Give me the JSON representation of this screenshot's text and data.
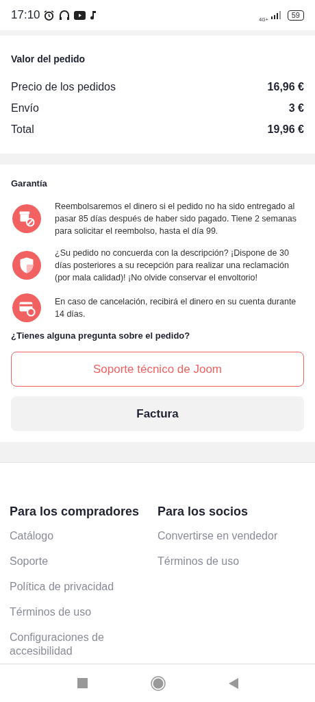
{
  "status_bar": {
    "time": "17:10",
    "network": "4G+",
    "battery": "59"
  },
  "order_value": {
    "title": "Valor del pedido",
    "rows": [
      {
        "label": "Precio de los pedidos",
        "value": "16,96 €"
      },
      {
        "label": "Envío",
        "value": "3 €"
      },
      {
        "label": "Total",
        "value": "19,96 €"
      }
    ]
  },
  "guarantee": {
    "title": "Garantía",
    "items": [
      {
        "kind": "box",
        "text": "Reembolsaremos el dinero si el pedido no ha sido entregado al pasar 85 días después de haber sido pagado. Tiene 2 semanas para solicitar el reembolso, hasta el día 99."
      },
      {
        "kind": "shield",
        "text": "¿Su pedido no concuerda con la descripción? ¡Dispone de 30 días posteriores a su recepción para realizar una reclamación (por mala calidad)! ¡No olvide conservar el envoltorio!"
      },
      {
        "kind": "card",
        "text": "En caso de cancelación, recibirá el dinero en su cuenta durante 14 días."
      }
    ],
    "question": "¿Tienes alguna pregunta sobre el pedido?",
    "buttons": [
      {
        "kind": "outline",
        "label": "Soporte técnico de Joom"
      },
      {
        "kind": "filled",
        "label": "Factura"
      }
    ]
  },
  "footer": {
    "columns": [
      {
        "title": "Para los compradores",
        "links": [
          "Catálogo",
          "Soporte",
          "Política de privacidad",
          "Términos de uso",
          "Configuraciones de accesibilidad"
        ]
      },
      {
        "title": "Para los socios",
        "links": [
          "Convertirse en vendedor",
          "Términos de uso"
        ]
      }
    ]
  }
}
